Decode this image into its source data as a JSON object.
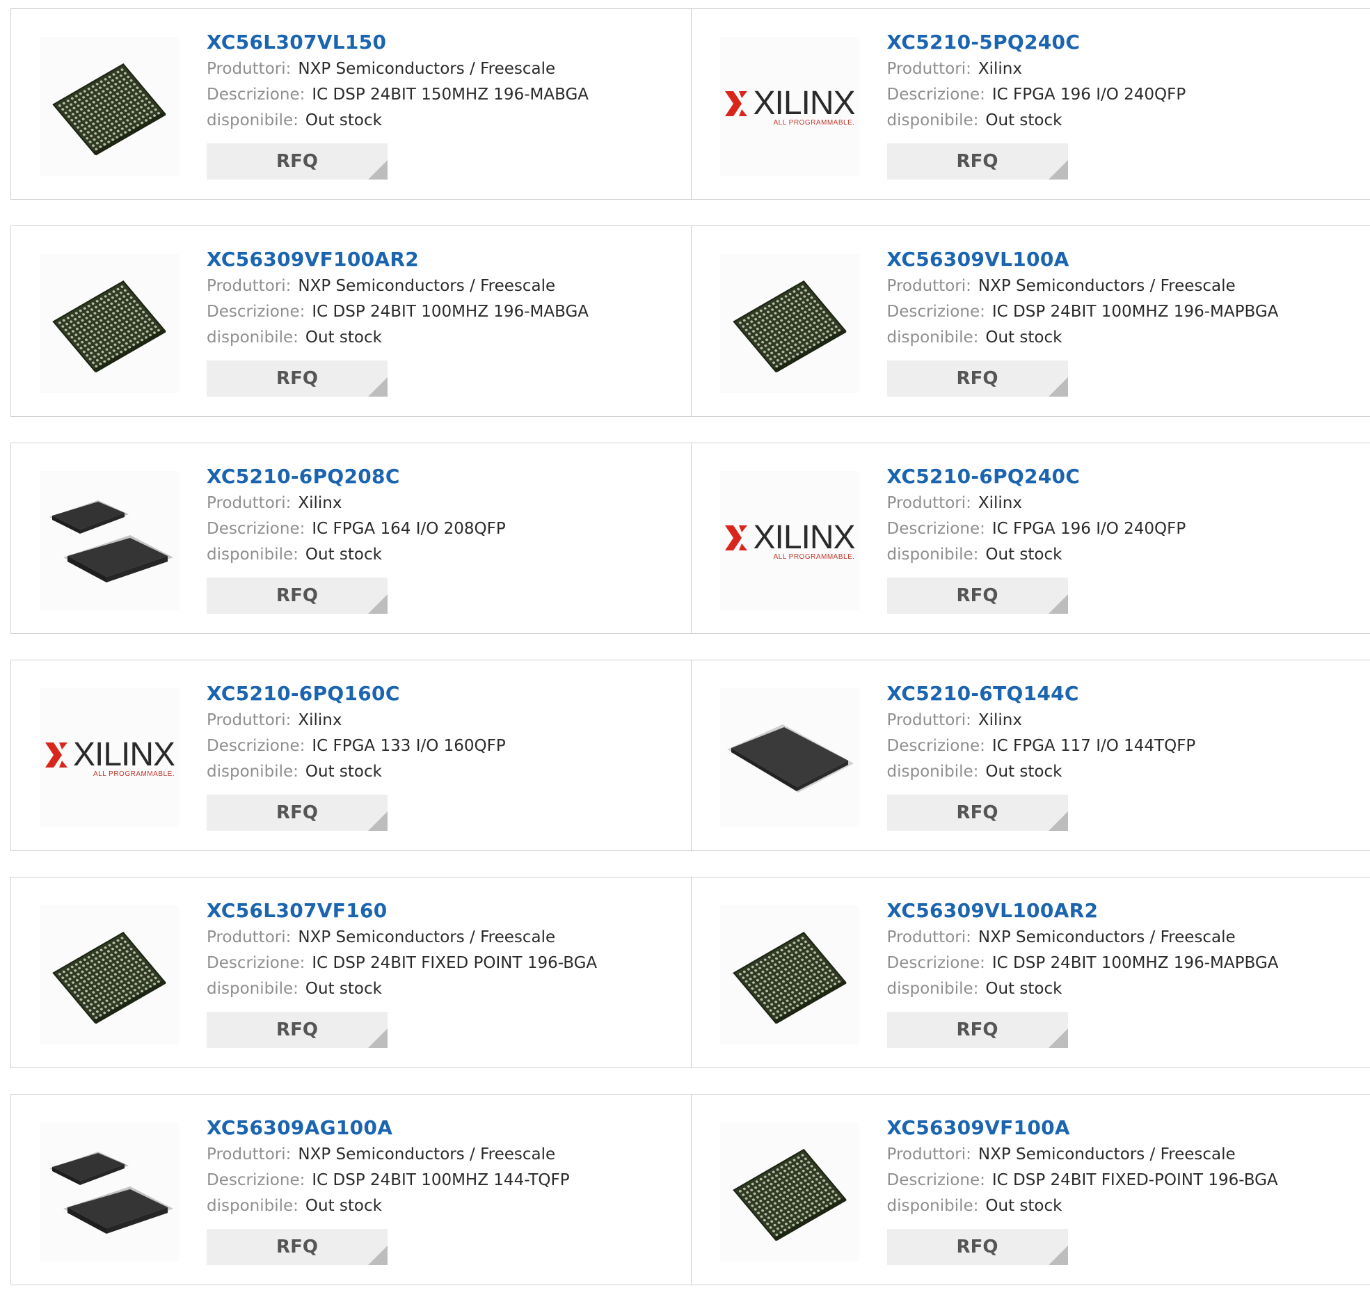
{
  "labels": {
    "manufacturer": "Produttori:",
    "description": "Descrizione:",
    "availability": "disponibile:",
    "rfq": "RFQ"
  },
  "logo": {
    "brand": "XILINX",
    "tagline": "ALL PROGRAMMABLE."
  },
  "products": [
    {
      "part": "XC56L307VL150",
      "manufacturer": "NXP Semiconductors / Freescale",
      "description": "IC DSP 24BIT 150MHZ 196-MABGA",
      "availability": "Out stock",
      "image": "bga-chip"
    },
    {
      "part": "XC5210-5PQ240C",
      "manufacturer": "Xilinx",
      "description": "IC FPGA 196 I/O 240QFP",
      "availability": "Out stock",
      "image": "xilinx-logo"
    },
    {
      "part": "XC56309VF100AR2",
      "manufacturer": "NXP Semiconductors / Freescale",
      "description": "IC DSP 24BIT 100MHZ 196-MABGA",
      "availability": "Out stock",
      "image": "bga-chip"
    },
    {
      "part": "XC56309VL100A",
      "manufacturer": "NXP Semiconductors / Freescale",
      "description": "IC DSP 24BIT 100MHZ 196-MAPBGA",
      "availability": "Out stock",
      "image": "bga-chip"
    },
    {
      "part": "XC5210-6PQ208C",
      "manufacturer": "Xilinx",
      "description": "IC FPGA 164 I/O 208QFP",
      "availability": "Out stock",
      "image": "qfp-pair"
    },
    {
      "part": "XC5210-6PQ240C",
      "manufacturer": "Xilinx",
      "description": "IC FPGA 196 I/O 240QFP",
      "availability": "Out stock",
      "image": "xilinx-logo"
    },
    {
      "part": "XC5210-6PQ160C",
      "manufacturer": "Xilinx",
      "description": "IC FPGA 133 I/O 160QFP",
      "availability": "Out stock",
      "image": "xilinx-logo"
    },
    {
      "part": "XC5210-6TQ144C",
      "manufacturer": "Xilinx",
      "description": "IC FPGA 117 I/O 144TQFP",
      "availability": "Out stock",
      "image": "tqfp-chip"
    },
    {
      "part": "XC56L307VF160",
      "manufacturer": "NXP Semiconductors / Freescale",
      "description": "IC DSP 24BIT FIXED POINT 196-BGA",
      "availability": "Out stock",
      "image": "bga-chip"
    },
    {
      "part": "XC56309VL100AR2",
      "manufacturer": "NXP Semiconductors / Freescale",
      "description": "IC DSP 24BIT 100MHZ 196-MAPBGA",
      "availability": "Out stock",
      "image": "bga-chip"
    },
    {
      "part": "XC56309AG100A",
      "manufacturer": "NXP Semiconductors / Freescale",
      "description": "IC DSP 24BIT 100MHZ 144-TQFP",
      "availability": "Out stock",
      "image": "qfp-pair"
    },
    {
      "part": "XC56309VF100A",
      "manufacturer": "NXP Semiconductors / Freescale",
      "description": "IC DSP 24BIT FIXED-POINT 196-BGA",
      "availability": "Out stock",
      "image": "bga-chip"
    }
  ],
  "colors": {
    "link": "#1a64b0",
    "label": "#8f8f8f",
    "value": "#2b2b2b",
    "button_bg": "#eeeeee",
    "xilinx_red": "#d9261c"
  }
}
